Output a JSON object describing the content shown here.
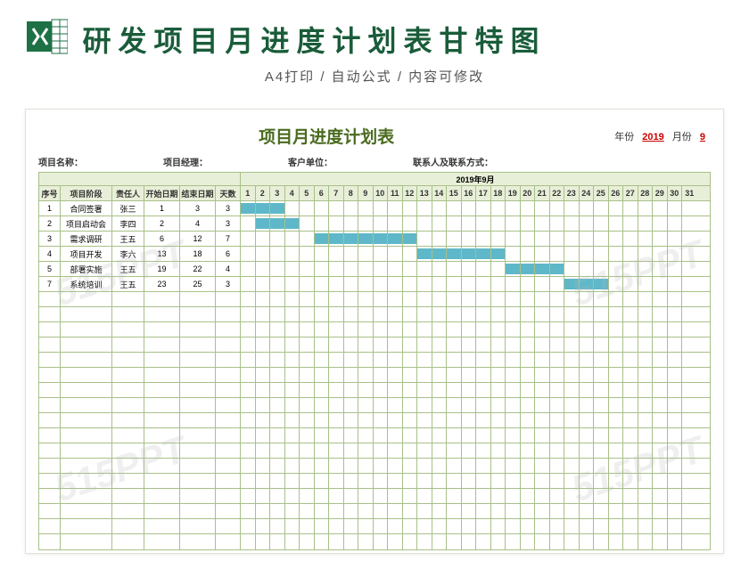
{
  "header": {
    "title": "研发项目月进度计划表甘特图",
    "subtitle": "A4打印 / 自动公式 / 内容可修改"
  },
  "sheet": {
    "title": "项目月进度计划表",
    "year_label": "年份",
    "year_value": "2019",
    "month_label": "月份",
    "month_value": "9",
    "month_header": "2019年9月",
    "meta": {
      "project_name": "项目名称：",
      "project_manager": "项目经理：",
      "client": "客户单位：",
      "contact": "联系人及联系方式："
    },
    "columns": {
      "seq": "序号",
      "stage": "项目阶段",
      "person": "责任人",
      "start": "开始日期",
      "end": "结束日期",
      "days": "天数"
    },
    "days_count": 31
  },
  "chart_data": {
    "type": "table",
    "title": "项目月进度计划表",
    "columns": [
      "序号",
      "项目阶段",
      "责任人",
      "开始日期",
      "结束日期",
      "天数"
    ],
    "gantt_month": "2019年9月",
    "gantt_days": 31,
    "rows": [
      {
        "seq": "1",
        "stage": "合同签署",
        "person": "张三",
        "start": 1,
        "end": 3,
        "days": 3
      },
      {
        "seq": "2",
        "stage": "项目启动会",
        "person": "李四",
        "start": 2,
        "end": 4,
        "days": 3
      },
      {
        "seq": "3",
        "stage": "需求调研",
        "person": "王五",
        "start": 6,
        "end": 12,
        "days": 7
      },
      {
        "seq": "4",
        "stage": "项目开发",
        "person": "李六",
        "start": 13,
        "end": 18,
        "days": 6
      },
      {
        "seq": "5",
        "stage": "部署实施",
        "person": "王五",
        "start": 19,
        "end": 22,
        "days": 4
      },
      {
        "seq": "7",
        "stage": "系统培训",
        "person": "王五",
        "start": 23,
        "end": 25,
        "days": 3
      }
    ],
    "empty_rows": 17
  },
  "watermark": "515PPT"
}
